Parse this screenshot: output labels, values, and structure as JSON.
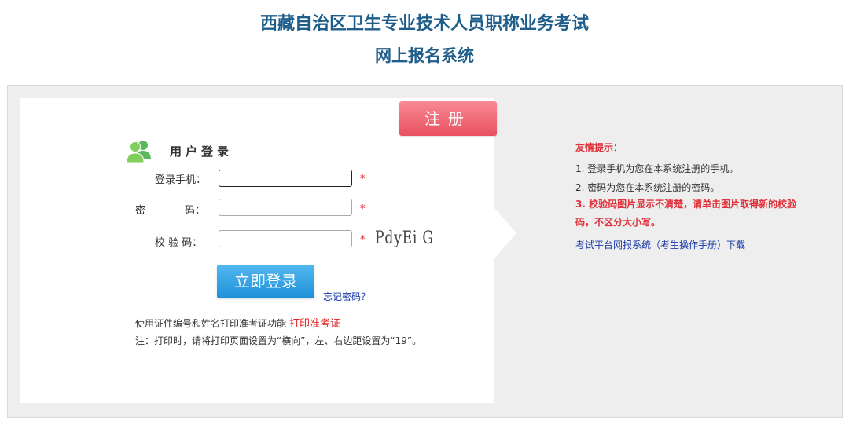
{
  "header": {
    "title_line1": "西藏自治区卫生专业技术人员职称业务考试",
    "title_line2": "网上报名系统"
  },
  "register_button": "注册",
  "login": {
    "title": "用户登录",
    "phone_label": "登录手机：",
    "password_label_a": "密",
    "password_label_b": "码：",
    "captcha_label": "校 验 码：",
    "required_mark": "*",
    "captcha_text": "PdyEi G",
    "submit_label": "立即登录",
    "forgot_link": "忘记密码？"
  },
  "print": {
    "intro": "使用证件编号和姓名打印准考证功能",
    "link": "打印准考证",
    "note": "注：打印时，请将打印页面设置为“横向”，左、右边距设置为“19”。"
  },
  "tips": {
    "title": "友情提示：",
    "item1": "1. 登录手机为您在本系统注册的手机。",
    "item2": "2. 密码为您在本系统注册的密码。",
    "item3": "3. 校验码图片显示不清楚，请单击图片取得新的校验码，不区分大小写。",
    "manual_link": "考试平台网报系统（考生操作手册）下载"
  },
  "colors": {
    "title_blue": "#1f5d8a",
    "register_red": "#e8505f",
    "login_blue": "#1f8fd9",
    "tip_red": "#e0303a",
    "link_blue": "#1a3aa8"
  },
  "icons": [
    "users-icon"
  ]
}
